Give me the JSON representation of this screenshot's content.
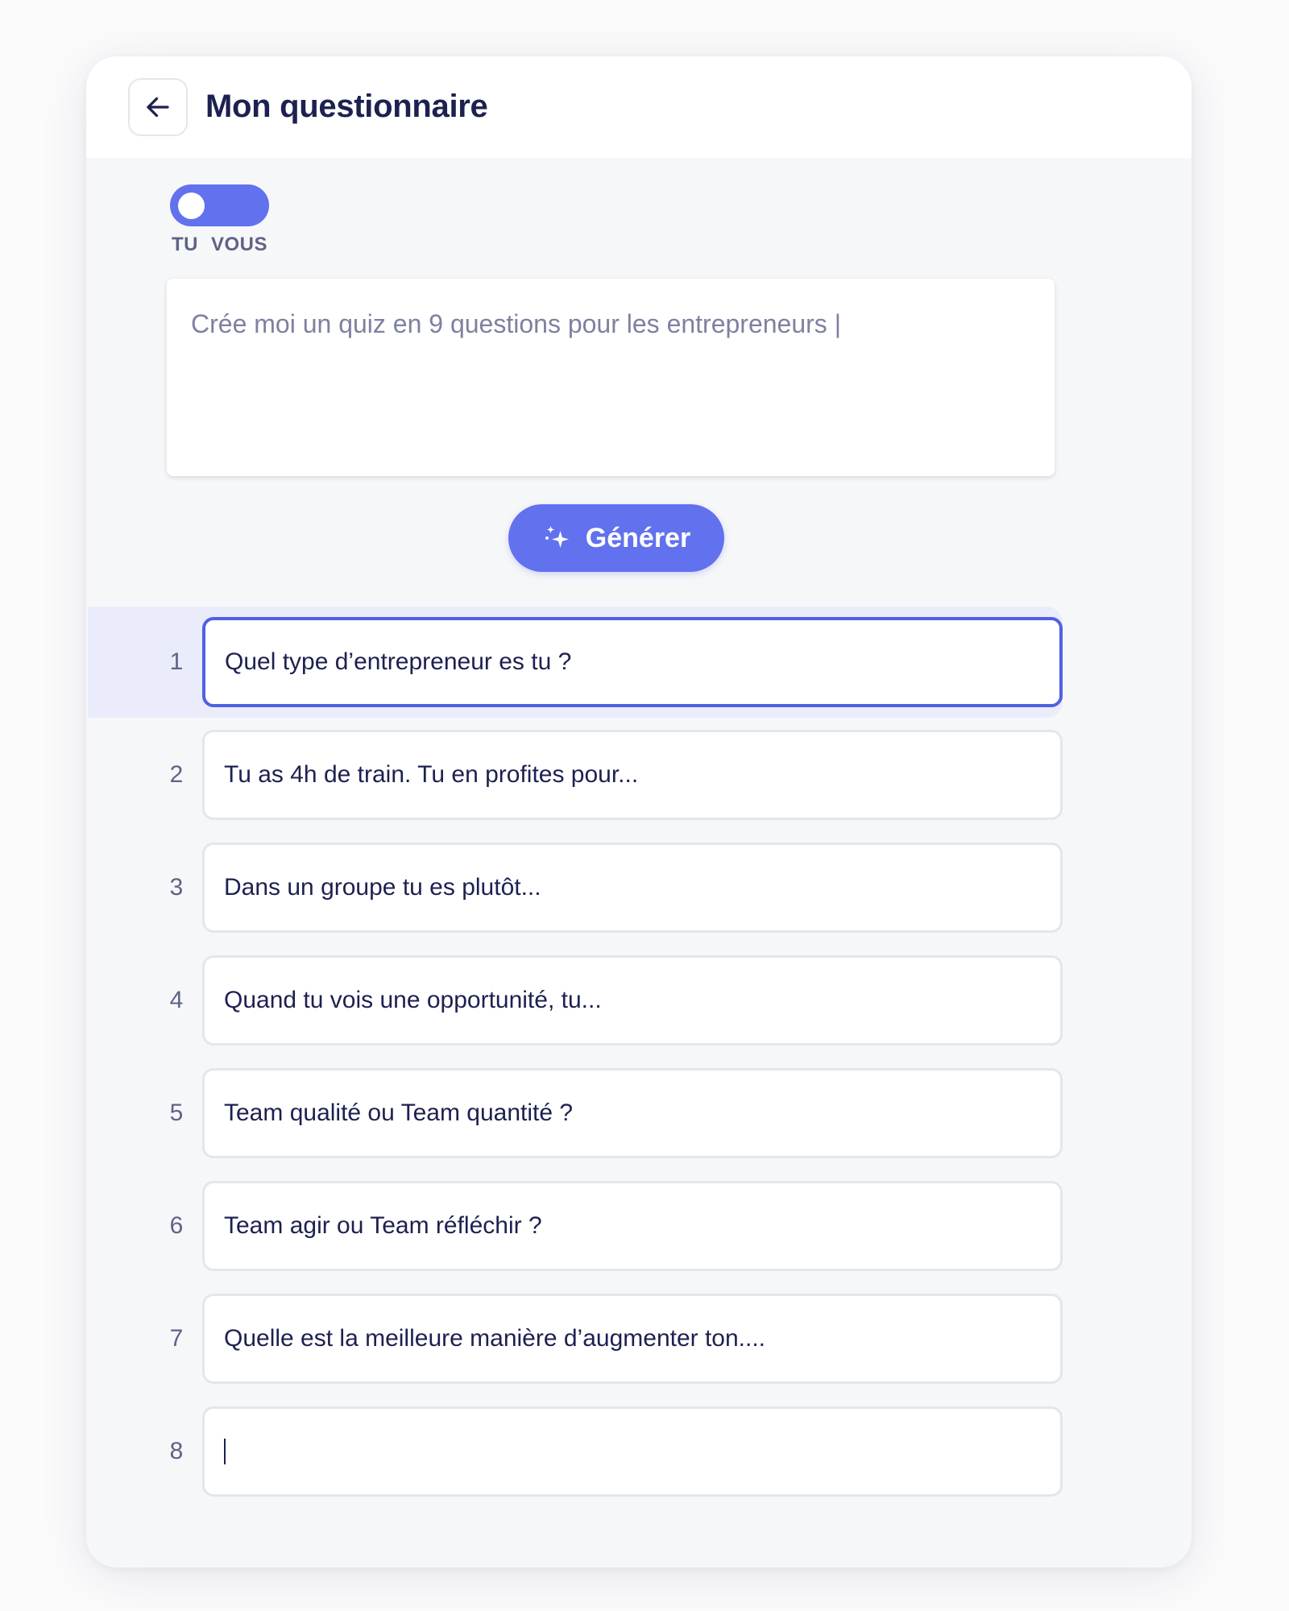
{
  "header": {
    "title": "Mon questionnaire",
    "back_icon": "arrow-left-icon"
  },
  "toggle": {
    "left_label": "TU",
    "right_label": "VOUS",
    "selected": "TU"
  },
  "prompt": {
    "value": "Crée moi un quiz en 9 questions pour les entrepreneurs |"
  },
  "generate": {
    "label": "Générer",
    "icon": "sparkles-icon"
  },
  "questions": [
    {
      "number": "1",
      "text": "Quel type d’entrepreneur es tu ?",
      "active": true
    },
    {
      "number": "2",
      "text": "Tu as 4h de train. Tu en profites pour..."
    },
    {
      "number": "3",
      "text": "Dans un groupe tu es plutôt..."
    },
    {
      "number": "4",
      "text": "Quand tu vois une opportunité, tu..."
    },
    {
      "number": "5",
      "text": "Team qualité ou Team quantité ?"
    },
    {
      "number": "6",
      "text": "Team agir ou Team réfléchir ?"
    },
    {
      "number": "7",
      "text": "Quelle est la meilleure manière d’augmenter ton...."
    },
    {
      "number": "8",
      "text": ""
    }
  ],
  "colors": {
    "accent": "#6271ee",
    "active_border": "#5060e4",
    "active_band": "#eaecfb",
    "text_dark": "#1c2150",
    "text_muted": "#7d81a0"
  }
}
